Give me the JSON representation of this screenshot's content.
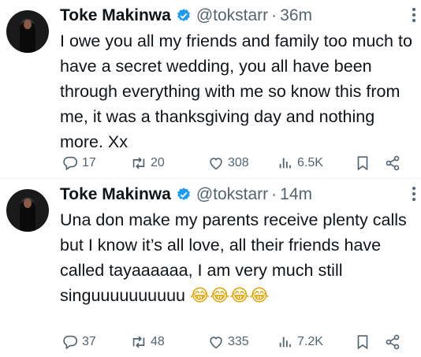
{
  "tweets": [
    {
      "author": "Toke Makinwa",
      "handle": "@tokstarr",
      "separator": "·",
      "time": "36m",
      "text": "I owe you all my friends and family too much to have a secret wedding, you all have been through everything with me so know this from me, it was a thanksgiving day and nothing more. Xx",
      "emoji": "",
      "replies": "17",
      "retweets": "20",
      "likes": "308",
      "views": "6.5K"
    },
    {
      "author": "Toke Makinwa",
      "handle": "@tokstarr",
      "separator": "·",
      "time": "14m",
      "text": "Una don make my parents receive plenty calls but I know it’s all love, all their friends have called tayaaaaaa, I am very much still singuuuuuuuuuu",
      "emoji": "😂😂😂😂",
      "replies": "37",
      "retweets": "48",
      "likes": "335",
      "views": "7.2K"
    }
  ],
  "icons": {
    "verified": "verified-badge-icon",
    "more": "more-options-icon",
    "reply": "reply-icon",
    "retweet": "retweet-icon",
    "like": "heart-icon",
    "views": "views-chart-icon",
    "bookmark": "bookmark-icon",
    "share": "share-icon"
  },
  "colors": {
    "verified": "#1d9bf0",
    "secondary": "#536471",
    "text": "#0f1419"
  }
}
